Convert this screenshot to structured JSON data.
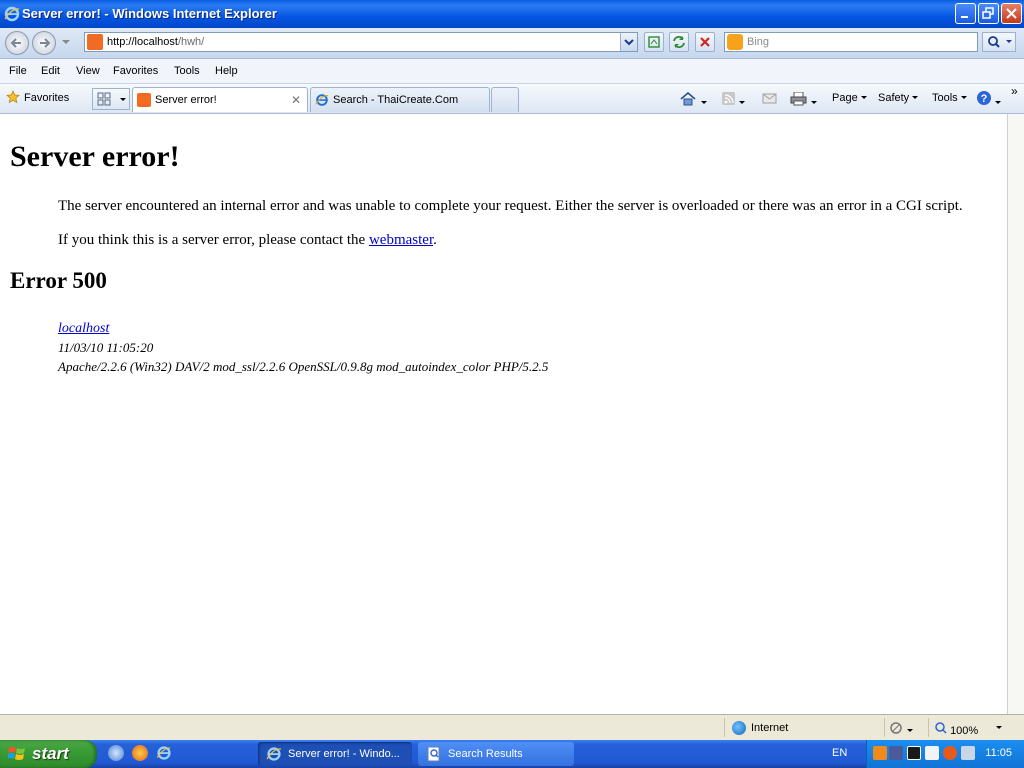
{
  "window": {
    "title": "Server error! - Windows Internet Explorer"
  },
  "address_bar": {
    "url_host": "http://localhost",
    "url_path": "/hwh/",
    "search_placeholder": "Bing"
  },
  "menu": [
    "File",
    "Edit",
    "View",
    "Favorites",
    "Tools",
    "Help"
  ],
  "favorites_label": "Favorites",
  "tabs": [
    {
      "label": "Server error!",
      "active": true
    },
    {
      "label": "Search - ThaiCreate.Com",
      "active": false
    }
  ],
  "command_bar": {
    "page": "Page",
    "safety": "Safety",
    "tools": "Tools"
  },
  "page": {
    "heading": "Server error!",
    "message1": "The server encountered an internal error and was unable to complete your request. Either the server is overloaded or there was an error in a CGI script.",
    "message2_prefix": "If you think this is a server error, please contact the ",
    "message2_link": "webmaster",
    "message2_suffix": ".",
    "error_heading": "Error 500",
    "address": {
      "host_link": "localhost",
      "timestamp": "11/03/10 11:05:20",
      "server_signature": "Apache/2.2.6 (Win32) DAV/2 mod_ssl/2.2.6 OpenSSL/0.9.8g mod_autoindex_color PHP/5.2.5"
    }
  },
  "status_bar": {
    "zone": "Internet",
    "zoom": "100%"
  },
  "taskbar": {
    "start_label": "start",
    "items": [
      {
        "label": "Server error! - Windo...",
        "active": true
      },
      {
        "label": "Search Results",
        "active": false
      }
    ],
    "language": "EN",
    "clock": "11:05"
  },
  "colors": {
    "link": "#0000cc",
    "titlebar": "#0a5fe3",
    "taskbar": "#2159d5",
    "start": "#3a9c35"
  }
}
